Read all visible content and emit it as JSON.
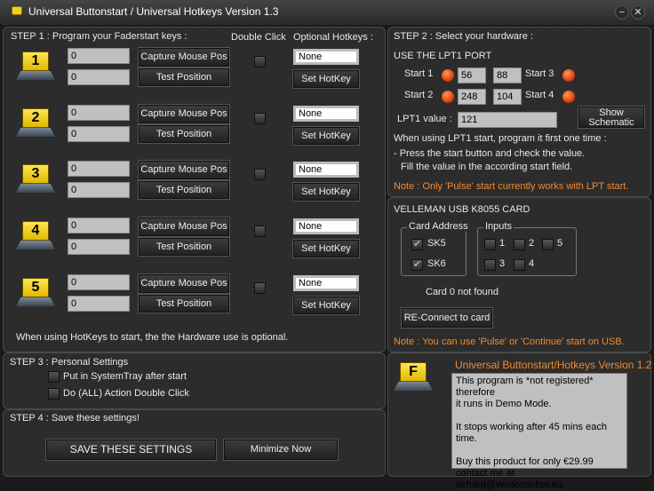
{
  "window": {
    "title": "Universal Buttonstart / Universal Hotkeys Version 1.3",
    "minimize": "−",
    "close": "✕"
  },
  "step1": {
    "heading": "STEP 1 : Program your Faderstart keys :",
    "double_click_header": "Double Click",
    "hotkeys_header": "Optional Hotkeys :",
    "rows": [
      {
        "key": "1",
        "x": "0",
        "y": "0",
        "capture": "Capture Mouse Pos",
        "test": "Test Position",
        "hotkey": "None",
        "set": "Set HotKey"
      },
      {
        "key": "2",
        "x": "0",
        "y": "0",
        "capture": "Capture Mouse Pos",
        "test": "Test Position",
        "hotkey": "None",
        "set": "Set HotKey"
      },
      {
        "key": "3",
        "x": "0",
        "y": "0",
        "capture": "Capture Mouse Pos",
        "test": "Test Position",
        "hotkey": "None",
        "set": "Set HotKey"
      },
      {
        "key": "4",
        "x": "0",
        "y": "0",
        "capture": "Capture Mouse Pos",
        "test": "Test Position",
        "hotkey": "None",
        "set": "Set HotKey"
      },
      {
        "key": "5",
        "x": "0",
        "y": "0",
        "capture": "Capture Mouse Pos",
        "test": "Test Position",
        "hotkey": "None",
        "set": "Set HotKey"
      }
    ],
    "note": "When using HotKeys to start, the the Hardware use is optional."
  },
  "step2": {
    "heading": "STEP 2 : Select your hardware :",
    "lpt_heading": "USE THE LPT1 PORT",
    "start1": "Start 1",
    "start2": "Start 2",
    "start3": "Start 3",
    "start4": "Start 4",
    "v1": "56",
    "v2": "248",
    "v3": "88",
    "v4": "104",
    "lpt_label": "LPT1 value :",
    "lpt_value": "121",
    "schematic_line1": "Show",
    "schematic_line2": "Schematic",
    "instr1": "When using LPT1 start, program it first one time :",
    "instr2": "- Press the start button and check the value.",
    "instr3": "Fill the value in the according start field.",
    "lpt_note": "Note : Only 'Pulse' start currently works with LPT start.",
    "usb_heading": "VELLEMAN USB K8055 CARD",
    "card_address": "Card Address",
    "sk5": "SK5",
    "sk6": "SK6",
    "inputs": "Inputs",
    "in1": "1",
    "in2": "2",
    "in3": "3",
    "in4": "4",
    "in5": "5",
    "card_status": "Card 0 not found",
    "reconnect": "RE-Connect to card",
    "usb_note": "Note : You can use  'Pulse' or 'Continue' start on USB."
  },
  "step3": {
    "heading": "STEP 3 : Personal Settings",
    "opt1": "Put in SystemTray after start",
    "opt2": "Do (ALL) Action Double Click"
  },
  "step4": {
    "heading": "STEP 4 : Save these settings!",
    "save": "SAVE THESE SETTINGS",
    "minimize": "Minimize Now"
  },
  "demo": {
    "key": "F",
    "title": "Universal Buttonstart/Hotkeys Version 1.2",
    "line1": "This program is *not registered* therefore",
    "line2": "it runs in Demo Mode.",
    "line3": "It stops working after 45 mins each time.",
    "line4": "Buy this product for only €29.99",
    "line5": "contact me at richard@verdonschot.eu"
  }
}
